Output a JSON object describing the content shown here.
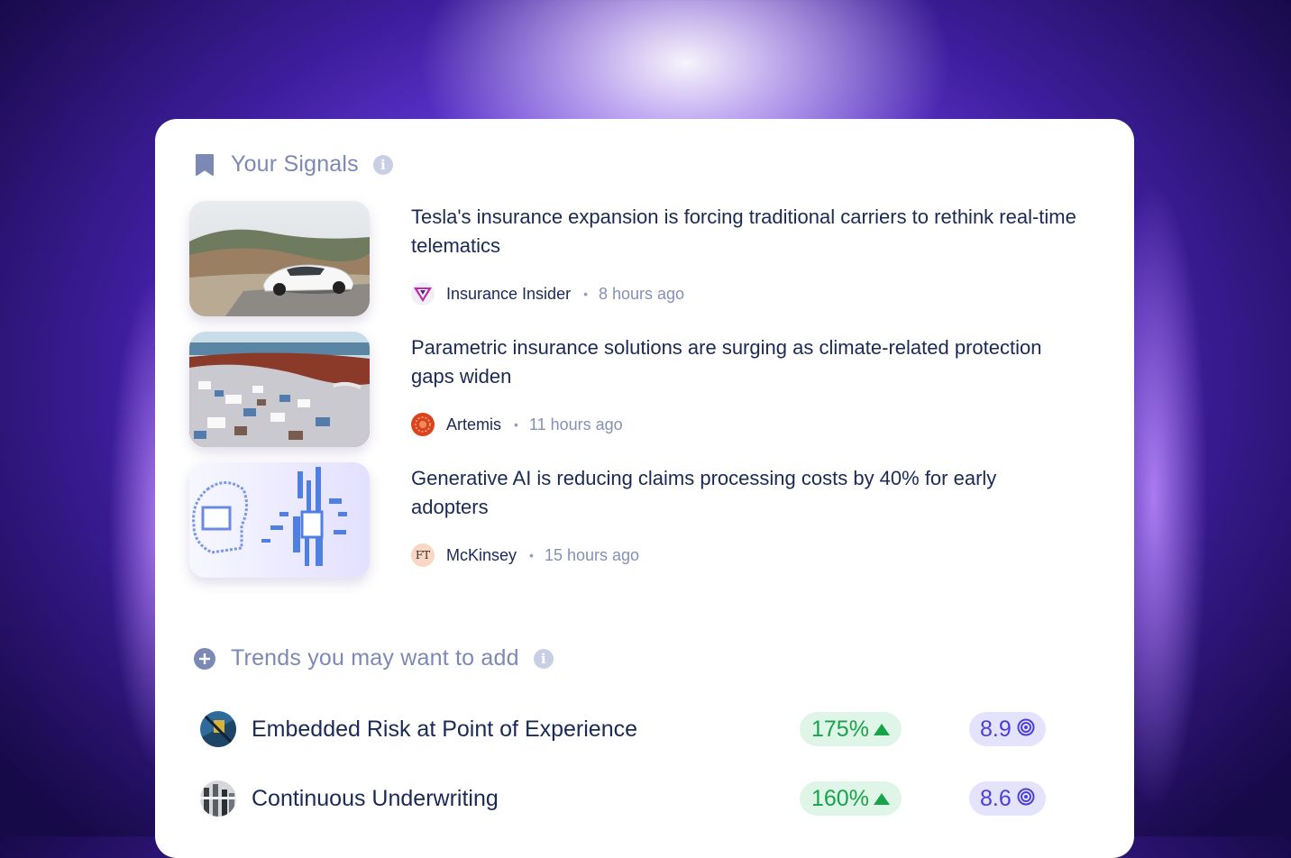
{
  "signals_section": {
    "title": "Your Signals",
    "items": [
      {
        "headline": "Tesla's insurance expansion is forcing traditional carriers to rethink real-time telematics",
        "source": "Insurance Insider",
        "time": "8 hours ago",
        "thumbnail": "white-electric-car-on-coastal-road",
        "source_icon": "insurance-insider-logo"
      },
      {
        "headline": "Parametric insurance solutions are surging as climate-related protection gaps widen",
        "source": "Artemis",
        "time": "11 hours ago",
        "thumbnail": "landfill-waste-by-sea",
        "source_icon": "artemis-logo"
      },
      {
        "headline": "Generative AI is reducing claims processing costs by 40% for early adopters",
        "source": "McKinsey",
        "time": "15 hours ago",
        "thumbnail": "ai-circuit-head-illustration",
        "source_icon": "ft-logo",
        "source_icon_text": "FT"
      }
    ]
  },
  "trends_section": {
    "title": "Trends you may want to add",
    "items": [
      {
        "name": "Embedded Risk at Point of Experience",
        "growth": "175%",
        "score": "8.9"
      },
      {
        "name": "Continuous Underwriting",
        "growth": "160%",
        "score": "8.6"
      }
    ]
  },
  "colors": {
    "accent": "#4b3fd6",
    "growth_bg": "#dff5e7",
    "growth_text": "#17a34a",
    "score_bg": "#e4e3fb",
    "headline": "#1b2a55",
    "muted": "#7c89b4"
  }
}
